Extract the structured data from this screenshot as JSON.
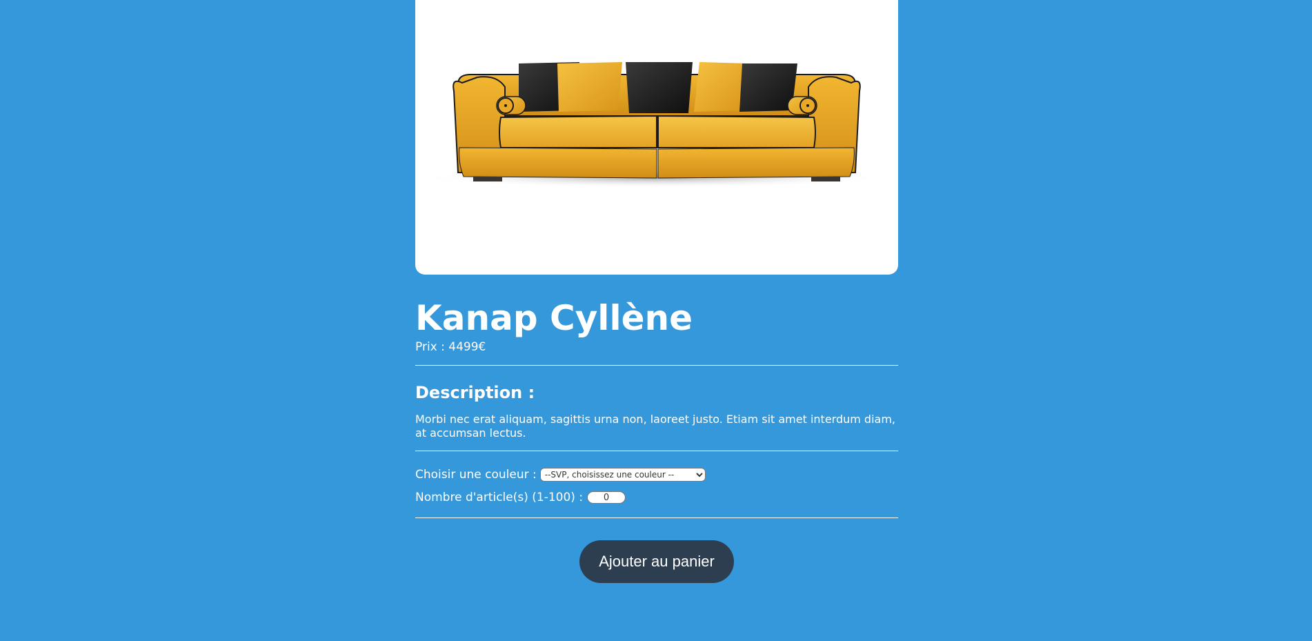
{
  "product": {
    "image_alt": "Photographie d'un canapé",
    "title": "Kanap Cyllène",
    "price_label": "Prix : ",
    "price_value": "4499",
    "currency": "€"
  },
  "description": {
    "heading": "Description :",
    "text": "Morbi nec erat aliquam, sagittis urna non, laoreet justo. Etiam sit amet interdum diam, at accumsan lectus."
  },
  "settings": {
    "color_label": "Choisir une couleur :",
    "color_selected": "--SVP, choisissez une couleur --",
    "quantity_label": "Nombre d'article(s) (1-100) :",
    "quantity_value": "0"
  },
  "cart": {
    "add_button_label": "Ajouter au panier"
  },
  "colors": {
    "background": "#3498db",
    "button": "#2c3e50",
    "sofa": "#e8a522",
    "cushion_dark": "#1c1c1c"
  }
}
